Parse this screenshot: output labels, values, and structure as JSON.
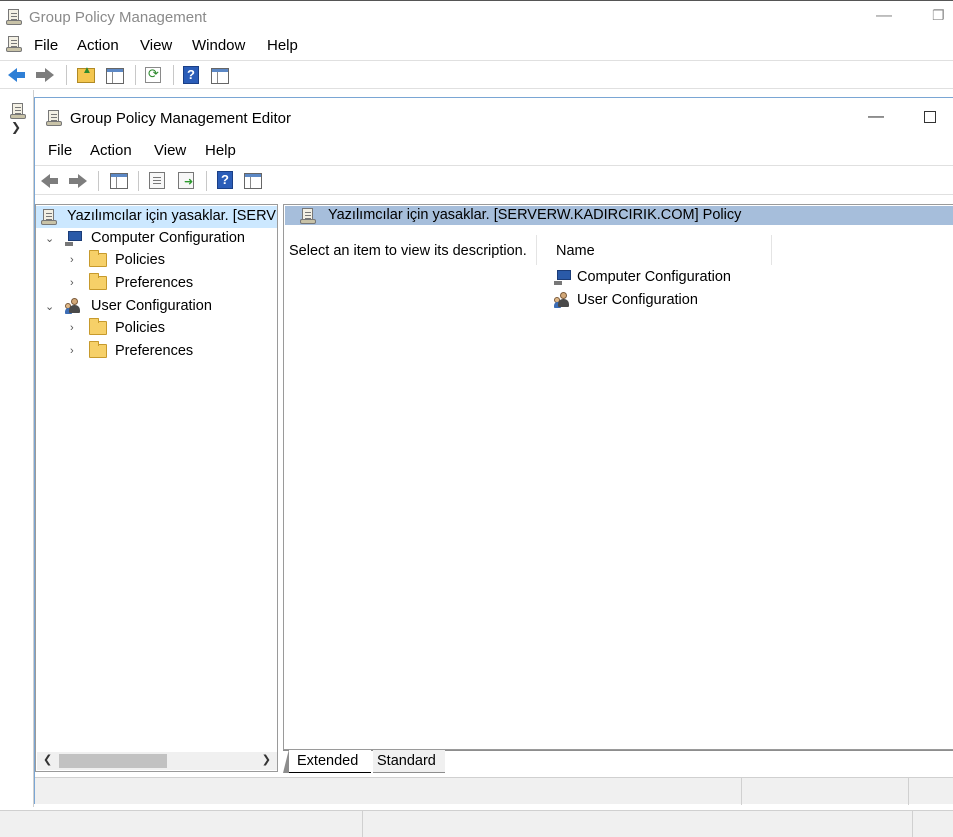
{
  "outer_window": {
    "title": "Group Policy Management",
    "menu": [
      "File",
      "Action",
      "View",
      "Window",
      "Help"
    ]
  },
  "inner_window": {
    "title": "Group Policy Management Editor",
    "menu": [
      "File",
      "Action",
      "View",
      "Help"
    ]
  },
  "tree": {
    "root": "Yazılımcılar için yasaklar. [SERVERW.KADIRCIRIK.COM] Policy",
    "computer_configuration": "Computer Configuration",
    "user_configuration": "User Configuration",
    "policies": "Policies",
    "preferences": "Preferences"
  },
  "details": {
    "header": "Yazılımcılar için yasaklar. [SERVERW.KADIRCIRIK.COM] Policy",
    "description": "Select an item to view its description.",
    "column_name": "Name",
    "items": [
      "Computer Configuration",
      "User Configuration"
    ]
  },
  "tabs": {
    "extended": "Extended",
    "standard": "Standard"
  },
  "icons": {
    "back": "back-arrow-icon",
    "forward": "forward-arrow-icon",
    "help": "help-icon"
  }
}
